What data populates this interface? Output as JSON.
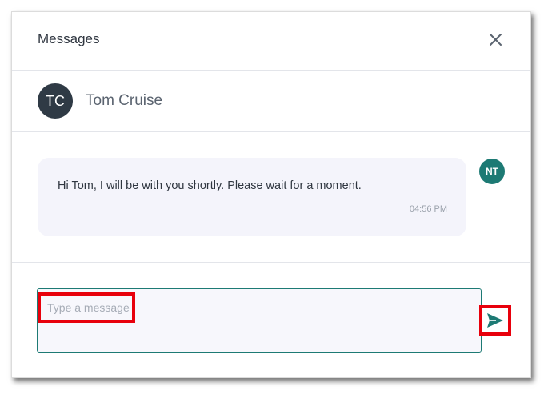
{
  "header": {
    "title": "Messages",
    "close_icon": "close-icon"
  },
  "contact": {
    "initials": "TC",
    "name": "Tom Cruise"
  },
  "messages": [
    {
      "text": "Hi Tom, I will be with you shortly. Please wait for a moment.",
      "time": "04:56 PM",
      "sender_initials": "NT"
    }
  ],
  "composer": {
    "placeholder": "Type a message",
    "value": "",
    "send_icon": "send-icon"
  },
  "colors": {
    "accent": "#1d7a74",
    "contact_avatar": "#2f3a45",
    "highlight": "#e8000c",
    "bubble_bg": "#f4f4fb"
  }
}
